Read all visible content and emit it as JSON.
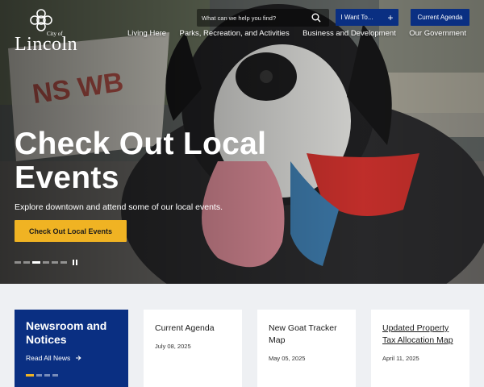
{
  "logo": {
    "city_of": "City of",
    "name": "Lincoln"
  },
  "search": {
    "placeholder": "What can we help you find?"
  },
  "header": {
    "i_want_to": "I Want To...",
    "current_agenda": "Current Agenda"
  },
  "nav": [
    "Living Here",
    "Parks, Recreation, and Activities",
    "Business and Development",
    "Our Government"
  ],
  "hero": {
    "title": "Check Out Local Events",
    "subtitle": "Explore downtown and attend some of our local events.",
    "cta": "Check Out Local Events",
    "slides": 6,
    "active_slide": 3
  },
  "newsroom": {
    "title": "Newsroom and Notices",
    "link": "Read All News"
  },
  "news_cards": [
    {
      "title": "Current Agenda",
      "date": "July 08, 2025"
    },
    {
      "title": "New Goat Tracker Map",
      "date": "May 05, 2025"
    },
    {
      "title": "Updated Property Tax Allocation Map",
      "date": "April 11, 2025"
    }
  ],
  "colors": {
    "primary": "#0a2f82",
    "accent": "#f0b323"
  }
}
